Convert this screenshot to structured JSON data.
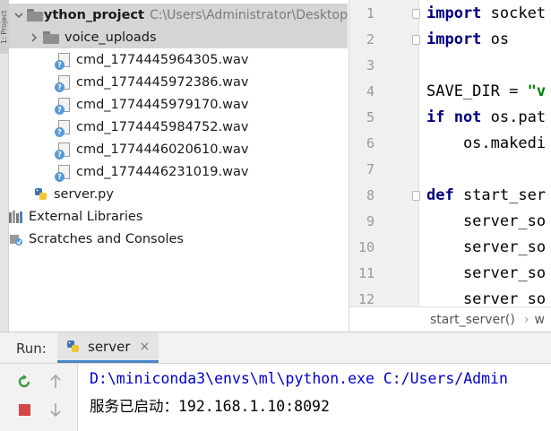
{
  "project_panel": {
    "strip_label": "1: Project",
    "root": {
      "name": "python_project",
      "path": "C:\\Users\\Administrator\\Desktop"
    },
    "folder": {
      "name": "voice_uploads"
    },
    "files": [
      "cmd_1774445964305.wav",
      "cmd_1774445972386.wav",
      "cmd_1774445979170.wav",
      "cmd_1774445984752.wav",
      "cmd_1774446020610.wav",
      "cmd_1774446231019.wav"
    ],
    "server_file": "server.py",
    "external_libraries": "External Libraries",
    "scratches": "Scratches and Consoles"
  },
  "editor": {
    "line_numbers": [
      "1",
      "2",
      "3",
      "4",
      "5",
      "6",
      "7",
      "8",
      "9",
      "10",
      "11",
      "12"
    ],
    "lines": [
      {
        "kw": "import",
        "rest": " socket"
      },
      {
        "kw": "import",
        "rest": " os"
      },
      {
        "kw": "",
        "rest": ""
      },
      {
        "kw": "",
        "rest": "SAVE_DIR = ",
        "str": "\"v"
      },
      {
        "kw": "if not",
        "rest": " os.pat"
      },
      {
        "kw": "",
        "rest": "    os.makedi"
      },
      {
        "kw": "",
        "rest": ""
      },
      {
        "kw": "def",
        "rest": " start_ser"
      },
      {
        "kw": "",
        "rest": "    server_so"
      },
      {
        "kw": "",
        "rest": "    server_so"
      },
      {
        "kw": "",
        "rest": "    server_so"
      },
      {
        "kw": "",
        "rest": "    server so"
      }
    ],
    "breadcrumb": "start_server()",
    "breadcrumb_next": "w"
  },
  "run": {
    "label": "Run:",
    "tab_label": "server",
    "close_symbol": "×",
    "console_lines": [
      "D:\\miniconda3\\envs\\ml\\python.exe C:/Users/Admin",
      "服务已启动：192.168.1.10:8092"
    ]
  },
  "colors": {
    "keyword": "#000080",
    "string": "#008000",
    "console_path": "#0000cc",
    "console_text": "#000000",
    "selection": "#d5d5d5"
  }
}
